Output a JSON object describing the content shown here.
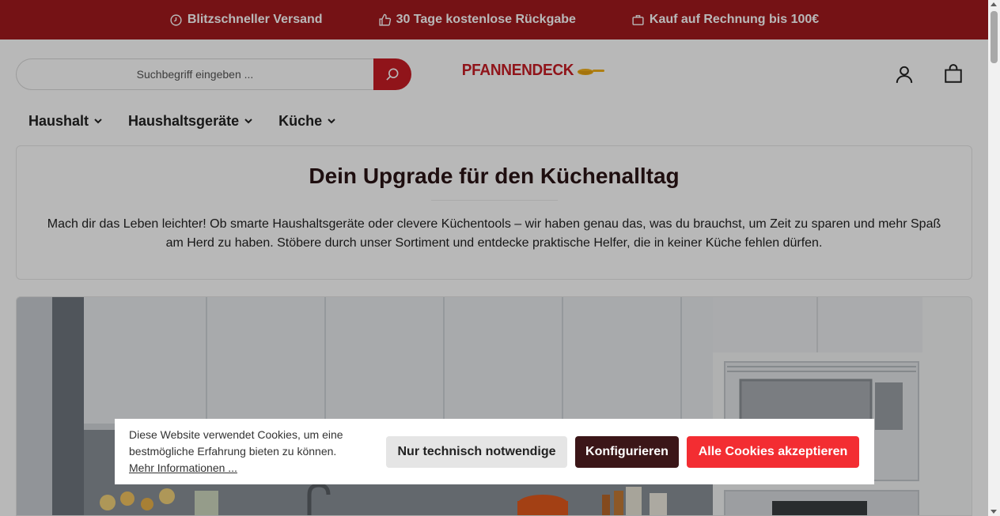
{
  "topbar": {
    "usps": [
      {
        "icon": "clock-icon",
        "label": "Blitzschneller Versand"
      },
      {
        "icon": "thumbs-up-icon",
        "label": "30 Tage kostenlose Rückgabe"
      },
      {
        "icon": "briefcase-icon",
        "label": "Kauf auf Rechnung bis 100€"
      }
    ],
    "background": "#a3191e"
  },
  "header": {
    "search": {
      "placeholder": "Suchbegriff eingeben ..."
    },
    "logo": {
      "text": "PFANNENDECK"
    },
    "icons": [
      "user-icon",
      "cart-icon"
    ]
  },
  "nav": {
    "items": [
      {
        "label": "Haushalt"
      },
      {
        "label": "Haushaltsgeräte"
      },
      {
        "label": "Küche"
      }
    ]
  },
  "intro": {
    "title": "Dein Upgrade für den Küchenalltag",
    "text": "Mach dir das Leben leichter! Ob smarte Haushaltsgeräte oder clevere Küchentools – wir haben genau das, was du brauchst, um Zeit zu sparen und mehr Spaß am Herd zu haben. Stöbere durch unser Sortiment und entdecke praktische Helfer, die in keiner Küche fehlen dürfen."
  },
  "cookie": {
    "text": "Diese Website verwendet Cookies, um eine bestmögliche Erfahrung bieten zu können.",
    "more_link": "Mehr Informationen ...",
    "btn_technical": "Nur technisch notwendige",
    "btn_configure": "Konfigurieren",
    "btn_accept": "Alle Cookies akzeptieren"
  },
  "colors": {
    "brand_red": "#c81d25",
    "accept_red": "#f32d32",
    "dark_brown": "#3b1618"
  }
}
